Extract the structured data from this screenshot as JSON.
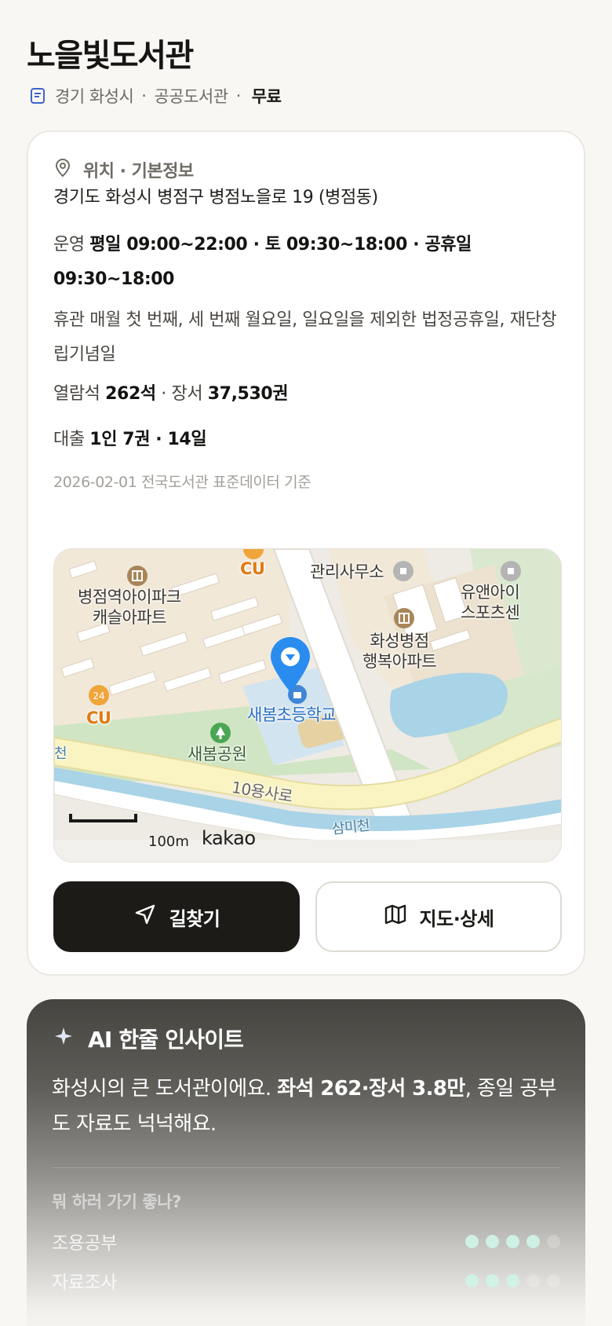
{
  "header": {
    "title": "노을빛도서관",
    "region": "경기 화성시",
    "separator": "·",
    "category": "공공도서관",
    "fee": "무료"
  },
  "info": {
    "section_title": "위치 · 기본정보",
    "address": "경기도 화성시 병점구 병점노을로 19 (병점동)",
    "hours_label": "운영",
    "hours_value": "평일 09:00~22:00 · 토 09:30~18:00 · 공휴일 09:30~18:00",
    "closed_text": "휴관 매월 첫 번째, 세 번째 월요일, 일요일을 제외한 법정공휴일, 재단창립기념일",
    "seats_label": "열람석",
    "seats_value": "262석",
    "books_label": "· 장서",
    "books_value": "37,530권",
    "loan_label": "대출",
    "loan_value": "1인 7권 · 14일",
    "source": "2026-02-01 전국도서관 표준데이터 기준"
  },
  "map": {
    "labels": {
      "apartment1": "병점역아이파크\n캐슬아파트",
      "office": "관리사무소",
      "apartment2": "화성병점\n행복아파트",
      "sports": "유앤아이\n스포츠센",
      "school": "새봄초등학교",
      "park": "새봄공원",
      "store_top": "CU",
      "store_left": "CU",
      "road": "10용사로",
      "stream": "삼미천",
      "stream_left": "천"
    },
    "scale": "100m",
    "provider": "kakao",
    "colors": {
      "pin": "#2b8cf0",
      "land": "#eeebe4",
      "residential": "#f0e6d6",
      "park": "#cfe6c4",
      "water": "#a9d3e6",
      "road": "#faf4c3"
    },
    "icons": [
      "apartment-icon",
      "store-icon",
      "park-icon",
      "school-icon",
      "office-icon",
      "location-pin-icon"
    ]
  },
  "actions": {
    "directions_label": "길찾기",
    "map_label": "지도·상세"
  },
  "ai": {
    "title": "AI 한줄 인사이트",
    "summary_pre": "화성시의 큰 도서관이에요. ",
    "summary_bold": "좌석 262·장서 3.8만",
    "summary_post": ", 종일 공부도 자료도 넉넉해요.",
    "question": "뭐 하러 가기 좋나?",
    "ratings": [
      {
        "label": "조용공부",
        "score": 4,
        "max": 5
      },
      {
        "label": "자료조사",
        "score": 3,
        "max": 5
      }
    ]
  }
}
